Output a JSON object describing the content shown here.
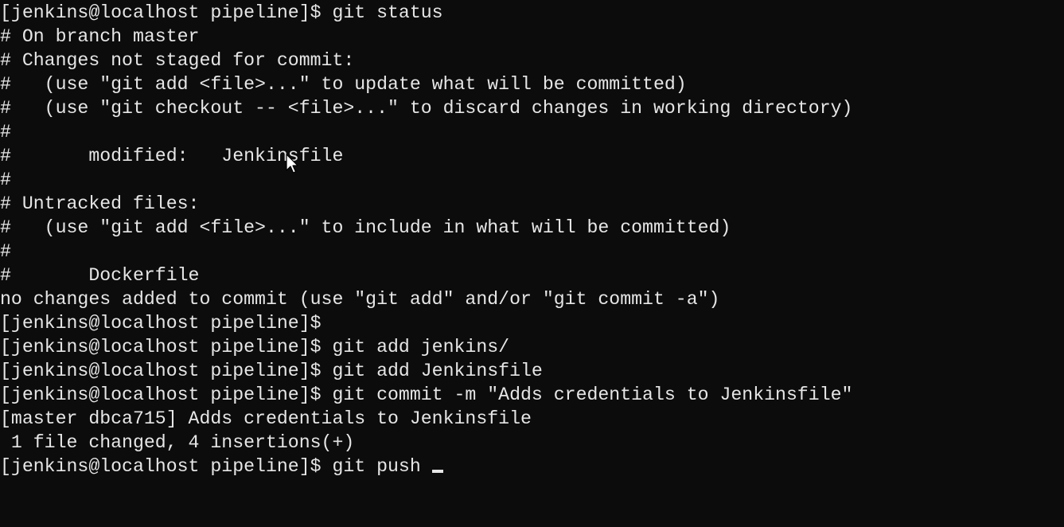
{
  "window": {
    "title": ""
  },
  "terminal": {
    "lines": [
      "[jenkins@localhost pipeline]$ git status",
      "# On branch master",
      "# Changes not staged for commit:",
      "#   (use \"git add <file>...\" to update what will be committed)",
      "#   (use \"git checkout -- <file>...\" to discard changes in working directory)",
      "#",
      "#       modified:   Jenkinsfile",
      "#",
      "# Untracked files:",
      "#   (use \"git add <file>...\" to include in what will be committed)",
      "#",
      "#       Dockerfile",
      "no changes added to commit (use \"git add\" and/or \"git commit -a\")",
      "[jenkins@localhost pipeline]$",
      "[jenkins@localhost pipeline]$ git add jenkins/",
      "[jenkins@localhost pipeline]$ git add Jenkinsfile",
      "[jenkins@localhost pipeline]$ git commit -m \"Adds credentials to Jenkinsfile\"",
      "[master dbca715] Adds credentials to Jenkinsfile",
      " 1 file changed, 4 insertions(+)"
    ],
    "prompt_line": "[jenkins@localhost pipeline]$ git push ",
    "colors": {
      "background": "#0c0c0c",
      "foreground": "#e6e6e6"
    }
  }
}
